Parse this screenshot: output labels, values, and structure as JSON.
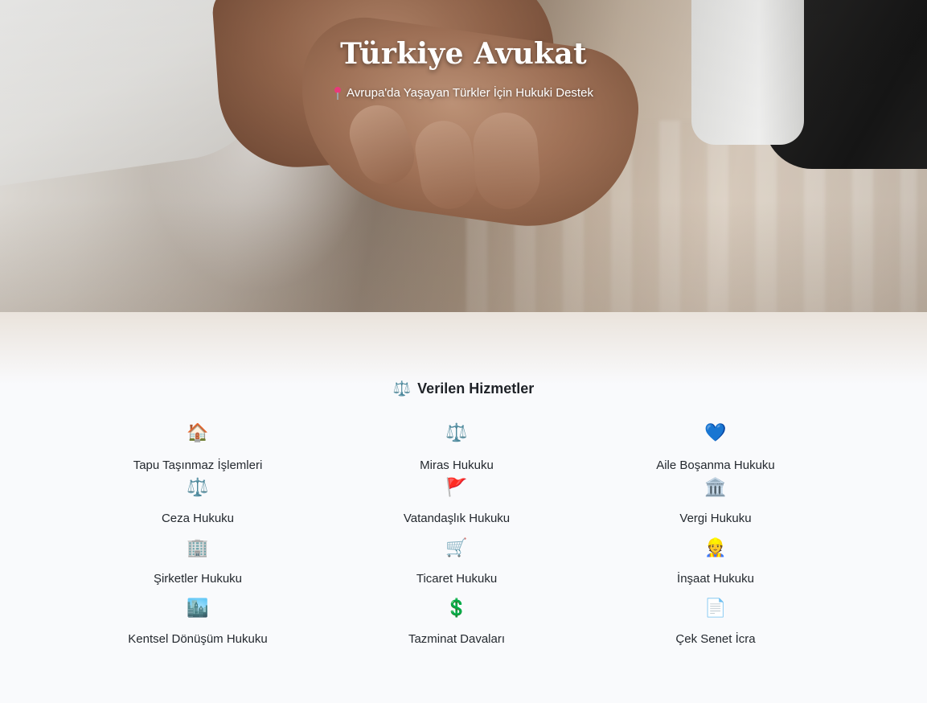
{
  "hero": {
    "title": "Türkiye Avukat",
    "subtitle_icon": "round-pushpin-icon",
    "subtitle": "Avrupa'da Yaşayan Türkler İçin Hukuki Destek"
  },
  "services": {
    "title_icon": "⚖️",
    "title": "Verilen Hizmetler",
    "items": [
      {
        "icon": "🏠",
        "icon_name": "house-icon",
        "label": "Tapu Taşınmaz İşlemleri"
      },
      {
        "icon": "⚖️",
        "icon_name": "scales-icon",
        "label": "Miras Hukuku"
      },
      {
        "icon": "💙",
        "icon_name": "blue-heart-icon",
        "label": "Aile Boşanma Hukuku"
      },
      {
        "icon": "⚖️",
        "icon_name": "scales-icon",
        "label": "Ceza Hukuku"
      },
      {
        "icon": "🚩",
        "icon_name": "red-flag-icon",
        "label": "Vatandaşlık Hukuku"
      },
      {
        "icon": "🏛️",
        "icon_name": "classical-building-icon",
        "label": "Vergi Hukuku"
      },
      {
        "icon": "🏢",
        "icon_name": "office-building-icon",
        "label": "Şirketler Hukuku"
      },
      {
        "icon": "🛒",
        "icon_name": "shopping-cart-icon",
        "label": "Ticaret Hukuku"
      },
      {
        "icon": "👷",
        "icon_name": "workers-icon",
        "label": "İnşaat Hukuku"
      },
      {
        "icon": "🏙️",
        "icon_name": "cityscape-icon",
        "label": "Kentsel Dönüşüm Hukuku"
      },
      {
        "icon": "💲",
        "icon_name": "dollar-sign-icon",
        "label": "Tazminat Davaları"
      },
      {
        "icon": "📄",
        "icon_name": "document-icon",
        "label": "Çek Senet İcra"
      }
    ]
  }
}
